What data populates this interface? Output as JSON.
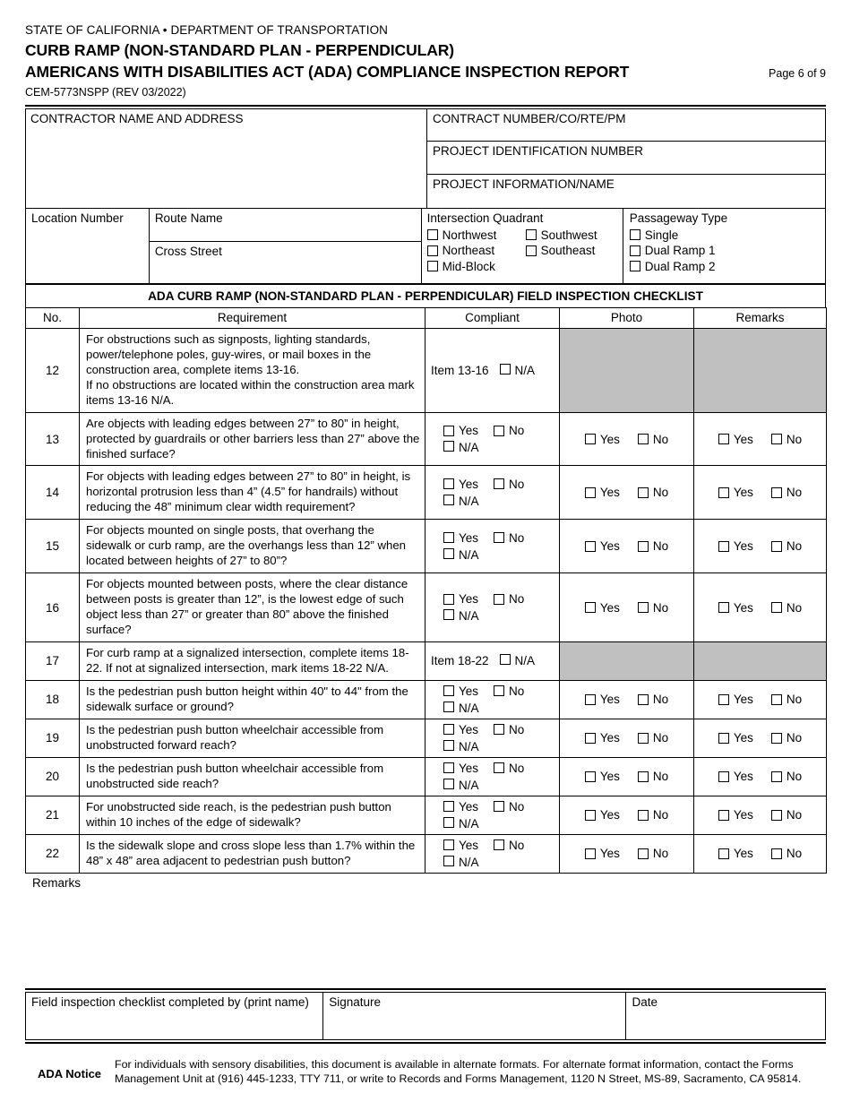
{
  "header": {
    "agency": "STATE OF CALIFORNIA • DEPARTMENT OF TRANSPORTATION",
    "title_line1": "CURB RAMP (NON-STANDARD PLAN - PERPENDICULAR)",
    "title_line2": "AMERICANS WITH DISABILITIES ACT (ADA) COMPLIANCE INSPECTION REPORT",
    "form_number": "CEM-5773NSPP (REV 03/2022)",
    "page_label": "Page 6 of 9"
  },
  "info_block": {
    "contractor_label": "CONTRACTOR NAME AND ADDRESS",
    "contract_number_label": "CONTRACT NUMBER/CO/RTE/PM",
    "project_id_label": "PROJECT IDENTIFICATION NUMBER",
    "project_info_label": "PROJECT INFORMATION/NAME"
  },
  "location_block": {
    "location_number_label": "Location Number",
    "route_name_label": "Route Name",
    "cross_street_label": "Cross Street",
    "intersection_quadrant_label": "Intersection Quadrant",
    "quadrant_options": [
      "Northwest",
      "Southwest",
      "Northeast",
      "Southeast",
      "Mid-Block"
    ],
    "passageway_type_label": "Passageway Type",
    "passageway_options": [
      "Single",
      "Dual Ramp 1",
      "Dual Ramp 2"
    ]
  },
  "checklist": {
    "title": "ADA CURB RAMP (NON-STANDARD PLAN - PERPENDICULAR) FIELD INSPECTION CHECKLIST",
    "columns": [
      "No.",
      "Requirement",
      "Compliant",
      "Photo",
      "Remarks"
    ],
    "labels": {
      "yes": "Yes",
      "no": "No",
      "na": "N/A"
    },
    "rows": [
      {
        "no": "12",
        "requirement": "For obstructions such as signposts, lighting standards, power/telephone poles, guy-wires, or mail boxes in the construction area, complete items 13-16.\nIf no obstructions are located within the construction area mark items 13-16 N/A.",
        "compliant_type": "item_na",
        "item_na_text": "Item 13-16",
        "photo_shaded": true,
        "remarks_shaded": true
      },
      {
        "no": "13",
        "requirement": "Are objects with leading edges between 27” to 80” in height, protected by guardrails or other barriers less than 27” above the finished surface?",
        "compliant_type": "yes_no_na",
        "photo_shaded": false,
        "remarks_shaded": false
      },
      {
        "no": "14",
        "requirement": "For objects with leading edges between 27” to 80” in height, is horizontal protrusion less than 4” (4.5” for handrails) without reducing the 48” minimum clear width requirement?",
        "compliant_type": "yes_no_na",
        "photo_shaded": false,
        "remarks_shaded": false
      },
      {
        "no": "15",
        "requirement": "For objects mounted on single posts, that overhang the sidewalk or curb ramp, are the overhangs less than 12” when located between heights of 27” to 80”?",
        "compliant_type": "yes_no_na",
        "photo_shaded": false,
        "remarks_shaded": false
      },
      {
        "no": "16",
        "requirement": "For objects mounted between posts, where the clear distance between posts is greater than 12”, is the lowest edge of such object less than 27” or greater than 80” above the finished surface?",
        "compliant_type": "yes_no_na",
        "photo_shaded": false,
        "remarks_shaded": false
      },
      {
        "no": "17",
        "requirement": "For curb ramp at a signalized intersection, complete items 18-22. If not at signalized intersection, mark items 18-22 N/A.",
        "compliant_type": "item_na",
        "item_na_text": "Item 18-22",
        "photo_shaded": true,
        "remarks_shaded": true
      },
      {
        "no": "18",
        "requirement": "Is the pedestrian push button height within 40\" to 44\" from the sidewalk surface or ground?",
        "compliant_type": "yes_no_na",
        "photo_shaded": false,
        "remarks_shaded": false
      },
      {
        "no": "19",
        "requirement": "Is the pedestrian push button wheelchair accessible from unobstructed forward reach?",
        "compliant_type": "yes_no_na",
        "photo_shaded": false,
        "remarks_shaded": false
      },
      {
        "no": "20",
        "requirement": "Is the pedestrian push button wheelchair accessible from unobstructed side reach?",
        "compliant_type": "yes_no_na",
        "photo_shaded": false,
        "remarks_shaded": false
      },
      {
        "no": "21",
        "requirement": "For unobstructed side reach, is the pedestrian push button within 10 inches of the edge of sidewalk?",
        "compliant_type": "yes_no_na",
        "photo_shaded": false,
        "remarks_shaded": false
      },
      {
        "no": "22",
        "requirement": "Is the sidewalk slope and cross slope less than 1.7% within the 48” x 48” area adjacent to pedestrian push button?",
        "compliant_type": "yes_no_na",
        "photo_shaded": false,
        "remarks_shaded": false
      }
    ]
  },
  "remarks_section": {
    "label": "Remarks"
  },
  "signature_block": {
    "completed_by_label": "Field inspection checklist completed by (print name)",
    "signature_label": "Signature",
    "date_label": "Date"
  },
  "ada_notice": {
    "label": "ADA Notice",
    "text": "For individuals with sensory disabilities, this document is available in alternate formats. For alternate format information, contact the Forms Management Unit at (916) 445-1233, TTY 711, or write to Records and Forms Management, 1120 N Street, MS-89, Sacramento, CA 95814."
  }
}
